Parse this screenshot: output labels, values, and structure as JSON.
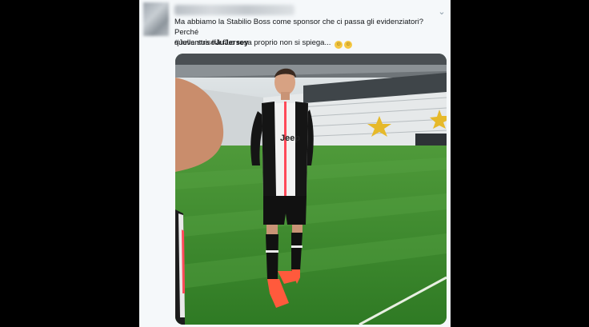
{
  "tweet": {
    "text_line1": "Ma abbiamo la Stabilio Boss come sponsor che ci passa gli evidenziatori? Perché",
    "text_line2": "quella striscia fluo rosa proprio non si spiega...",
    "emoji": [
      "relieved-face-emoji",
      "face-with-tongue-emoji"
    ],
    "hashtag_1": "#Juventus",
    "hashtag_2": "#JuJersey"
  },
  "photo": {
    "jersey_sponsor": "Jeep",
    "subject": "player in black and white striped kit on stadium pitch"
  },
  "colors": {
    "background": "#000000",
    "card": "#f5f8fa",
    "pitch": "#3b8a2c",
    "fluo_pink": "#ff4a5a",
    "boots": "#ff5a3c"
  }
}
